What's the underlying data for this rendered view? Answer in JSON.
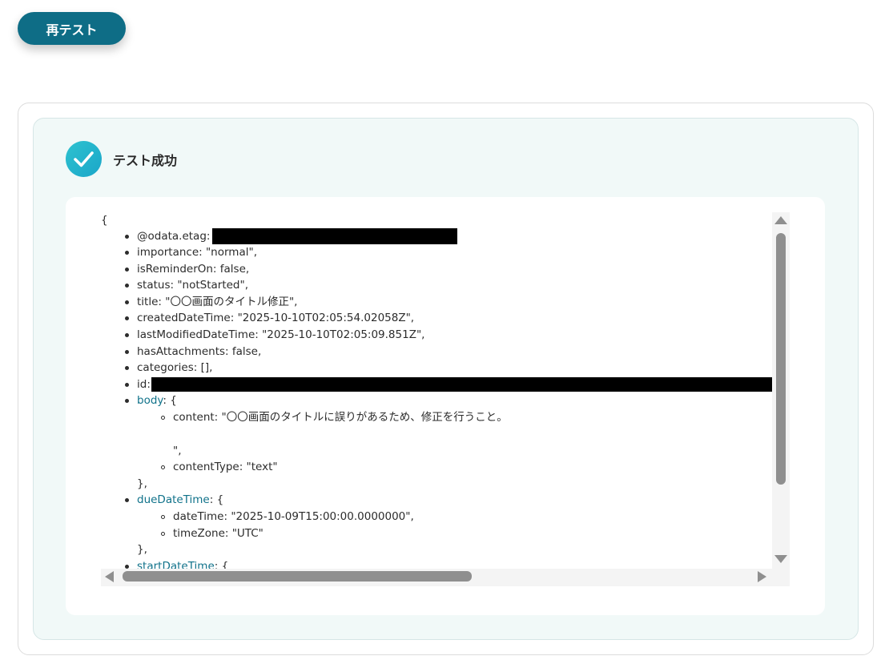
{
  "retest_button": {
    "label": "再テスト"
  },
  "result": {
    "title": "テスト成功",
    "icon": "check-circle-icon"
  },
  "json_view": {
    "open_brace": "{",
    "fields": {
      "odata_etag": "@odata.etag:",
      "importance": "importance: \"normal\",",
      "is_reminder_on": "isReminderOn: false,",
      "status": "status: \"notStarted\",",
      "title": "title: \"〇〇画面のタイトル修正\",",
      "created": "createdDateTime: \"2025-10-10T02:05:54.02058Z\",",
      "modified": "lastModifiedDateTime: \"2025-10-10T02:05:09.851Z\",",
      "has_attachments": "hasAttachments: false,",
      "categories": "categories: [],",
      "id": "id:"
    },
    "body": {
      "key": "body",
      "suffix": ": {",
      "content": "content: \"〇〇画面のタイトルに誤りがあるため、修正を行うこと。",
      "content_end": "\",",
      "content_type": "contentType: \"text\"",
      "close": "},"
    },
    "due": {
      "key": "dueDateTime",
      "suffix": ": {",
      "date_time": "dateTime: \"2025-10-09T15:00:00.0000000\",",
      "time_zone": "timeZone: \"UTC\"",
      "close": "},"
    },
    "start": {
      "key": "startDateTime",
      "suffix": ": {"
    }
  },
  "colors": {
    "button_bg": "#0e6d86",
    "panel_bg": "#f1f9f8",
    "key_link": "#10728a",
    "check_gradient_start": "#2ec2cf",
    "check_gradient_end": "#1aa6c9",
    "scrollbar_thumb": "#8f8f8f"
  }
}
